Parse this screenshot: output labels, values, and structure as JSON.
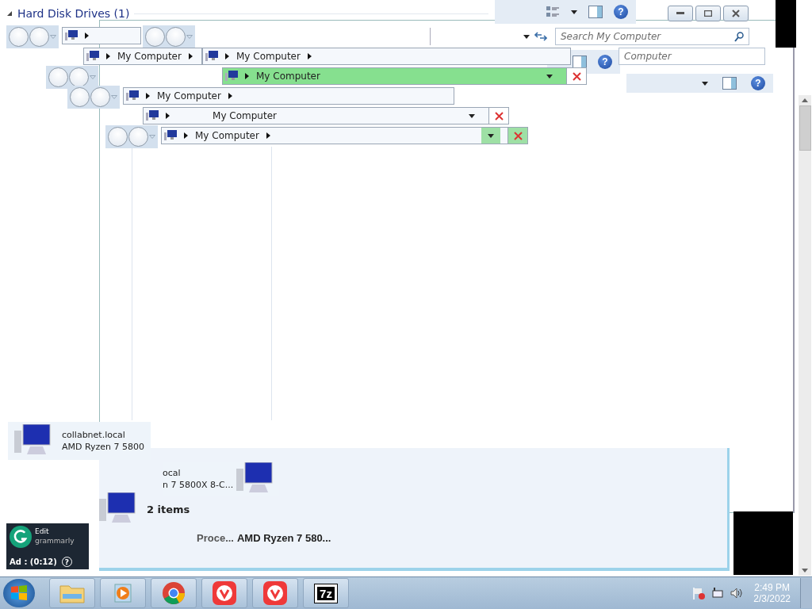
{
  "group_header": {
    "label": "Hard Disk Drives (1)",
    "expanded": true
  },
  "address_bars": [
    {
      "trailing_arrow": false,
      "dropdown": false,
      "close": false,
      "highlighted": false
    },
    {
      "text": "My Computer",
      "trailing_arrow": true,
      "dropdown": false,
      "close": false,
      "highlighted": false,
      "centered": false
    },
    {
      "text": "My Computer",
      "trailing_arrow": true,
      "dropdown": false,
      "close": false,
      "highlighted": false,
      "centered": false
    },
    {
      "text": "My Computer",
      "trailing_arrow": false,
      "dropdown": true,
      "close": true,
      "highlighted": true,
      "dropdown_highlighted": false,
      "centered": false
    },
    {
      "text": "My Computer",
      "trailing_arrow": true,
      "dropdown": false,
      "close": false,
      "highlighted": false,
      "centered": false
    },
    {
      "text": "My Computer",
      "trailing_arrow": false,
      "dropdown": true,
      "close": true,
      "highlighted": false,
      "dropdown_highlighted": false,
      "centered": true
    },
    {
      "text": "My Computer",
      "trailing_arrow": true,
      "dropdown": true,
      "close": true,
      "highlighted": false,
      "dropdown_highlighted": true,
      "centered": false
    }
  ],
  "toolbars": [
    {
      "help": "?"
    },
    {
      "help": "?"
    },
    {
      "help": "?"
    }
  ],
  "searches": [
    {
      "placeholder": "Search My Computer"
    },
    {
      "placeholder": "Computer"
    }
  ],
  "details": [
    {
      "name": "collabnet.local",
      "detail": "AMD Ryzen 7 5800"
    },
    {
      "name": "ocal",
      "detail": "n 7 5800X 8-C..."
    }
  ],
  "status": {
    "count": "2 items",
    "property_label": "Proce...",
    "property_value": "AMD Ryzen 7 580..."
  },
  "ad": {
    "title": "Edit",
    "brand": "grammarly",
    "timer": "Ad : (0:12)",
    "help": "?"
  },
  "taskbar": {
    "apps": [
      {
        "kind": "explorer"
      },
      {
        "kind": "media"
      },
      {
        "kind": "chrome"
      },
      {
        "kind": "vivaldi"
      },
      {
        "kind": "vivaldi"
      },
      {
        "kind": "sevenzip",
        "label": "7z"
      }
    ],
    "time": "2:49 PM",
    "date": "2/3/2022"
  }
}
